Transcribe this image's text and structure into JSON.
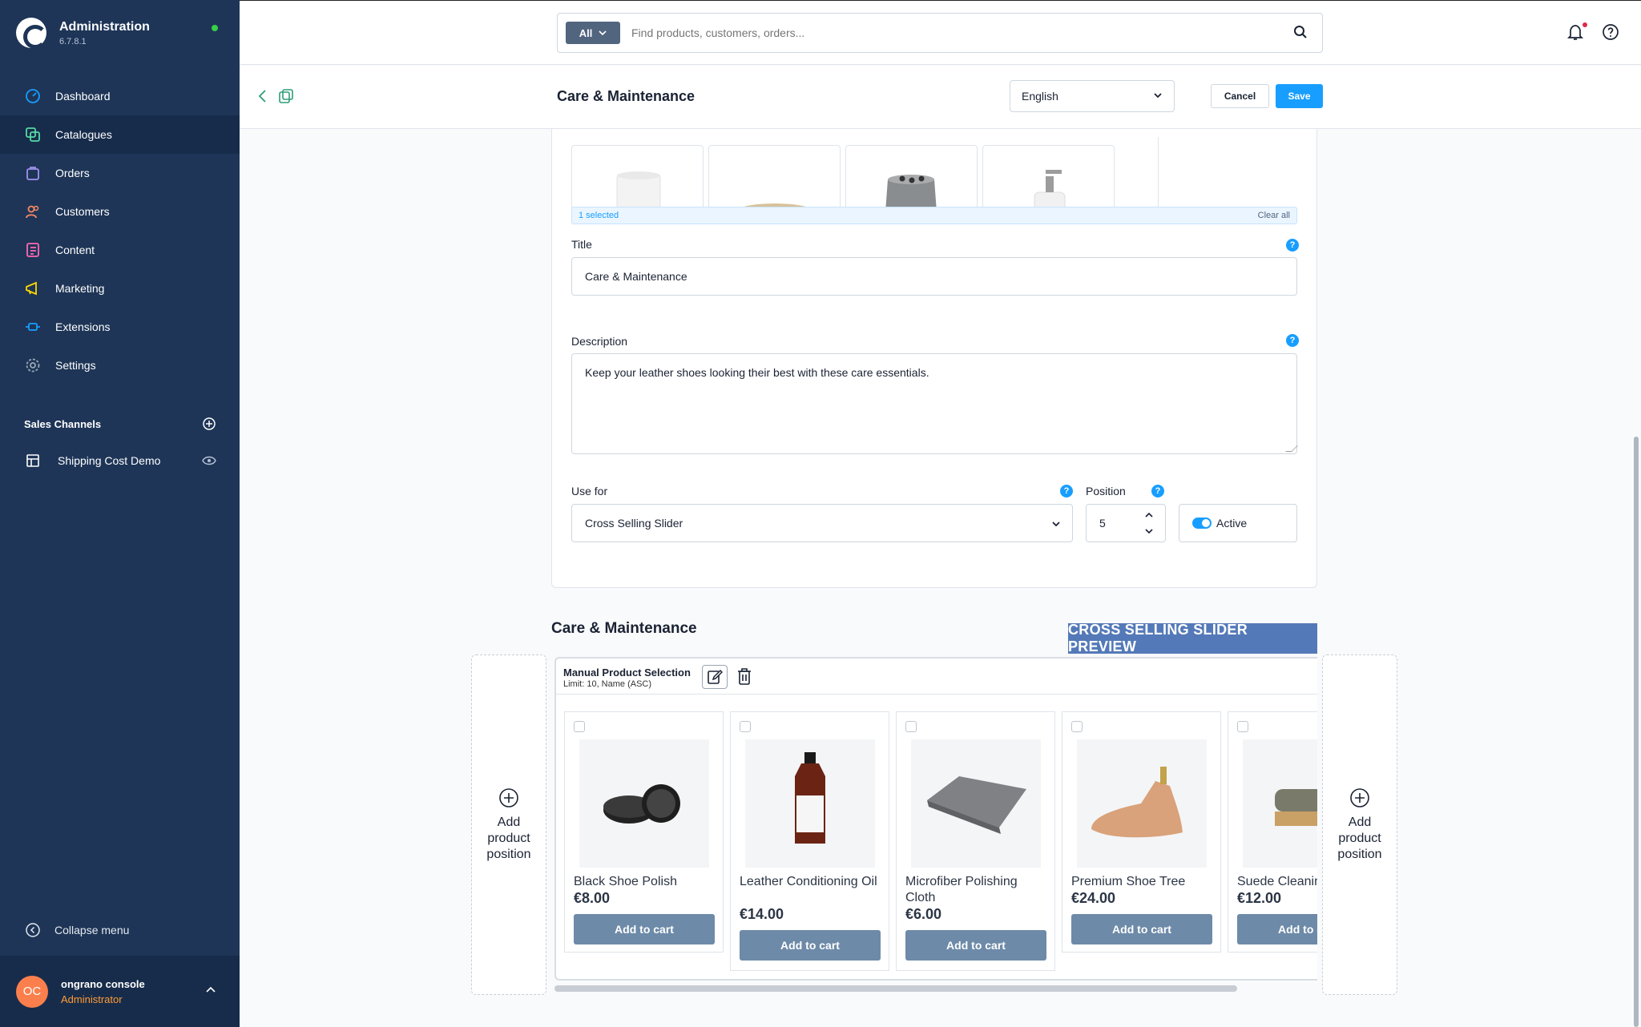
{
  "app": {
    "title": "Administration",
    "version": "6.7.8.1"
  },
  "nav": [
    {
      "label": "Dashboard",
      "icon": "dashboard-icon",
      "color": "#189eff"
    },
    {
      "label": "Catalogues",
      "icon": "catalogue-icon",
      "color": "#57d9a3"
    },
    {
      "label": "Orders",
      "icon": "orders-icon",
      "color": "#a092f0"
    },
    {
      "label": "Customers",
      "icon": "customers-icon",
      "color": "#f88962"
    },
    {
      "label": "Content",
      "icon": "content-icon",
      "color": "#ff68b4"
    },
    {
      "label": "Marketing",
      "icon": "marketing-icon",
      "color": "#ffd700"
    },
    {
      "label": "Extensions",
      "icon": "extensions-icon",
      "color": "#189eff"
    },
    {
      "label": "Settings",
      "icon": "settings-icon",
      "color": "#9aa8b5"
    }
  ],
  "sales_channels": {
    "title": "Sales Channels",
    "items": [
      {
        "label": "Shipping Cost Demo"
      }
    ]
  },
  "collapse_label": "Collapse menu",
  "user": {
    "initials": "OC",
    "name": "ongrano console",
    "role": "Administrator"
  },
  "search": {
    "scope": "All",
    "placeholder": "Find products, customers, orders..."
  },
  "header": {
    "title": "Care & Maintenance",
    "language": "English",
    "cancel": "Cancel",
    "save": "Save"
  },
  "selection": {
    "count_label": "1 selected",
    "clear_label": "Clear all"
  },
  "form": {
    "title_label": "Title",
    "title_value": "Care & Maintenance",
    "description_label": "Description",
    "description_value": "Keep your leather shoes looking their best with these care essentials.",
    "use_for_label": "Use for",
    "use_for_value": "Cross Selling Slider",
    "position_label": "Position",
    "position_value": "5",
    "active_label": "Active"
  },
  "preview": {
    "title": "Care & Maintenance",
    "banner": "CROSS SELLING SLIDER PREVIEW",
    "add_position_label": "Add product position",
    "block_title": "Manual Product Selection",
    "block_subtitle": "Limit: 10, Name (ASC)",
    "products": [
      {
        "name": "Black Shoe Polish",
        "price": "€8.00",
        "button": "Add to cart"
      },
      {
        "name": "Leather Conditioning Oil",
        "price": "€14.00",
        "button": "Add to cart"
      },
      {
        "name": "Microfiber Polishing Cloth",
        "price": "€6.00",
        "button": "Add to cart"
      },
      {
        "name": "Premium Shoe Tree",
        "price": "€24.00",
        "button": "Add to cart"
      },
      {
        "name": "Suede Cleaning Brush",
        "price": "€12.00",
        "button": "Add to cart"
      }
    ]
  }
}
